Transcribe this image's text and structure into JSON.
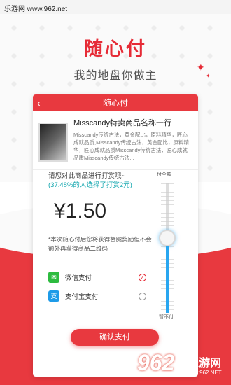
{
  "watermark": {
    "top_text": "乐游网 www.962.net"
  },
  "hero": {
    "title": "随心付",
    "subtitle": "我的地盘你做主"
  },
  "screen": {
    "title": "随心付",
    "back_icon": "‹",
    "product": {
      "name": "Misscandy特卖商品名称一行",
      "description": "Misscandy传统古法，黄金配比，原料精华，匠心成就品质,Misscandy传统古法，黄金配比，原料精华，匠心成就品质Misscandy传统古法，匠心成就品质Misscandy传统古法..."
    },
    "prompt": "请您对此商品进行打赏哦~",
    "ratio_text": "(37.48%的人选择了打赏2元)",
    "amount": "¥1.50",
    "notice": "*本次随心付后您将获得蟹腿奖励但不会额外再获得商品二维码",
    "slider": {
      "top_label": "付全款",
      "bottom_label": "暂不付",
      "level_percent": 58
    },
    "payments": [
      {
        "label": "微信支付",
        "icon": "wechat-pay-icon",
        "color": "#2dbb3f",
        "selected": true,
        "check": "✓"
      },
      {
        "label": "支付宝支付",
        "icon": "alipay-icon",
        "color": "#1e9be8",
        "selected": false,
        "check": ""
      }
    ],
    "confirm_label": "确认支付"
  },
  "logo": {
    "number": "962",
    "text": "乐游网",
    "url": "www.962.NET"
  },
  "colors": {
    "accent": "#e8393f",
    "teal": "#17a8b0",
    "slider": "#29a6f0"
  }
}
